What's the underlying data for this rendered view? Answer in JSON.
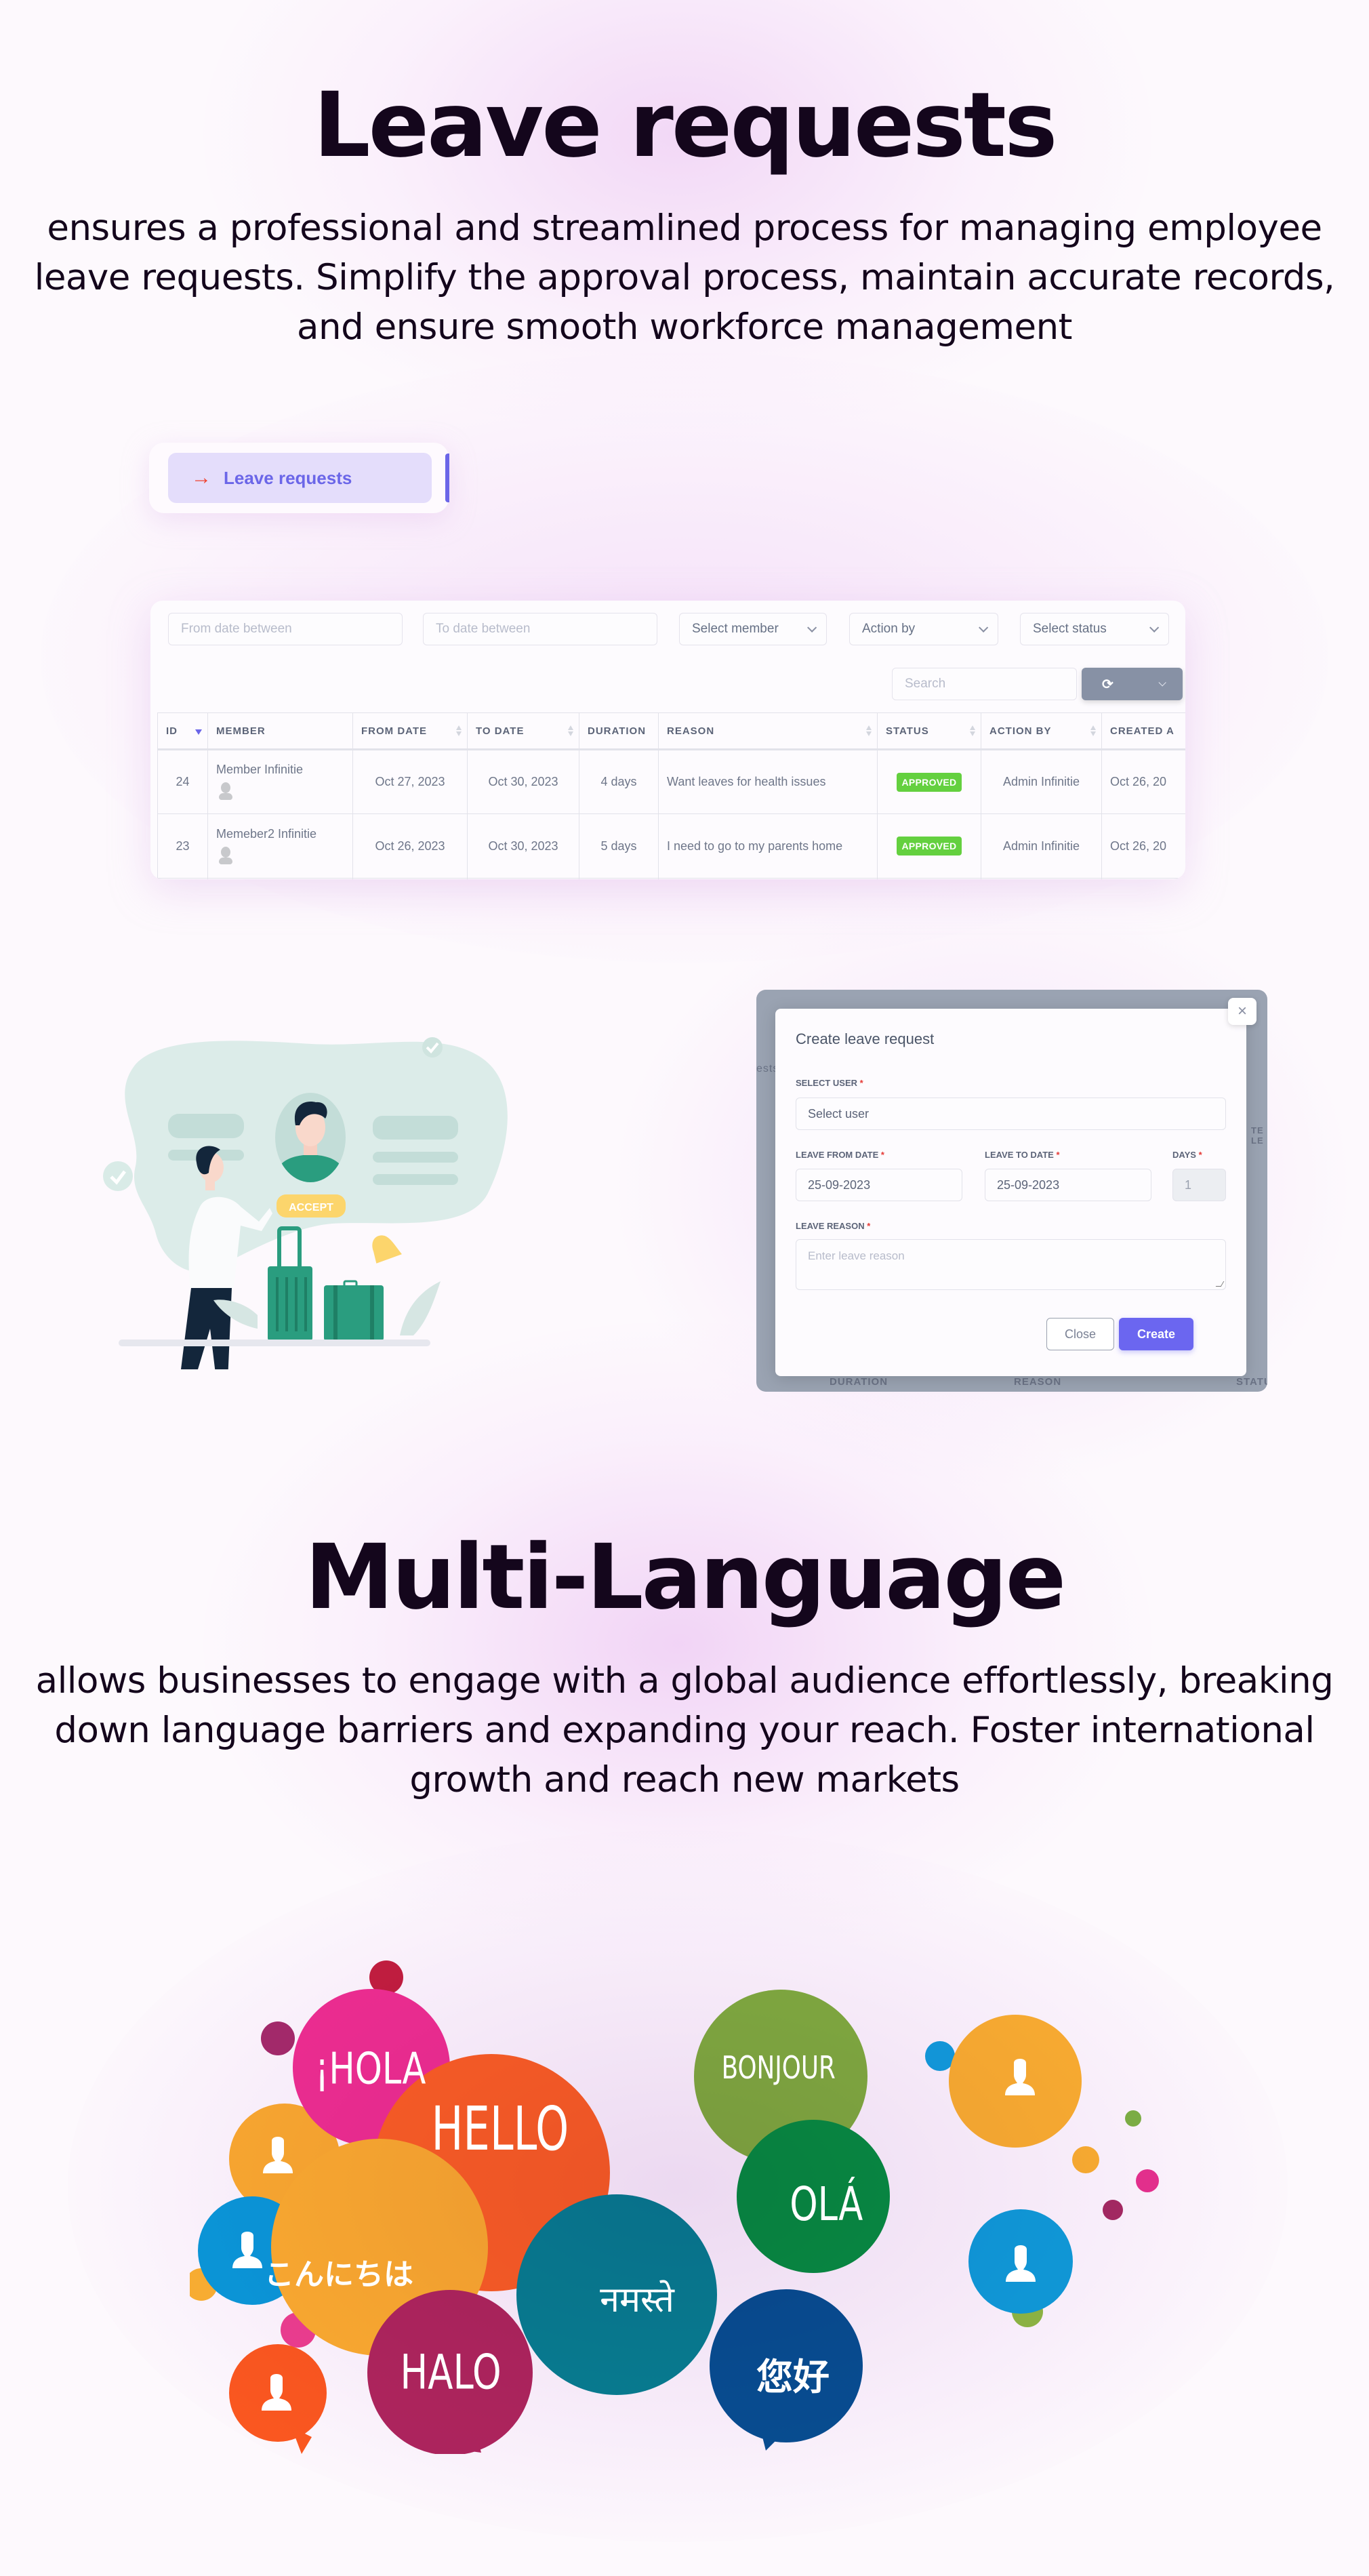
{
  "leave_section": {
    "title": "Leave requests",
    "description": "ensures a professional and streamlined process for managing employee leave requests. Simplify the approval process, maintain accurate records, and ensure smooth workforce management"
  },
  "nav": {
    "item_label": "Leave requests",
    "icon": "arrow-right-icon",
    "accent": "#6b66e8",
    "arrow_color": "#f0432f"
  },
  "table_view": {
    "filters": {
      "from_date_placeholder": "From date between",
      "to_date_placeholder": "To date between",
      "member_select": "Select member",
      "action_by_select": "Action by",
      "status_select": "Select status"
    },
    "search_placeholder": "Search",
    "refresh_icon": "refresh-icon",
    "columns": [
      "ID",
      "MEMBER",
      "FROM DATE",
      "TO DATE",
      "DURATION",
      "REASON",
      "STATUS",
      "ACTION BY",
      "CREATED A"
    ],
    "rows": [
      {
        "id": "24",
        "member": "Member Infinitie",
        "from": "Oct 27, 2023",
        "to": "Oct 30, 2023",
        "duration": "4 days",
        "reason": "Want leaves for health issues",
        "status": "APPROVED",
        "action_by": "Admin Infinitie",
        "created": "Oct 26, 20"
      },
      {
        "id": "23",
        "member": "Memeber2 Infinitie",
        "from": "Oct 26, 2023",
        "to": "Oct 30, 2023",
        "duration": "5 days",
        "reason": "I need to go to my parents home",
        "status": "APPROVED",
        "action_by": "Admin Infinitie",
        "created": "Oct 26, 20"
      }
    ],
    "status_color": "#64d03f"
  },
  "illustration": {
    "button_label": "ACCEPT"
  },
  "modal": {
    "title": "Create leave request",
    "select_user_label": "SELECT USER",
    "select_user_placeholder": "Select user",
    "from_date_label": "LEAVE FROM DATE",
    "from_date_value": "25-09-2023",
    "to_date_label": "LEAVE TO DATE",
    "to_date_value": "25-09-2023",
    "days_label": "DAYS",
    "days_value": "1",
    "reason_label": "LEAVE REASON",
    "reason_placeholder": "Enter leave reason",
    "required_mark": "*",
    "close_label": "Close",
    "create_label": "Create",
    "close_icon": "×",
    "backdrop_texts": {
      "left": "ests",
      "right": "TE LE",
      "duration": "DURATION",
      "reason": "REASON",
      "status": "STATU"
    },
    "create_color": "#6b66f0"
  },
  "language_section": {
    "title": "Multi-Language",
    "description": "allows businesses to engage with a global audience effortlessly, breaking down language barriers and expanding your reach. Foster international growth and reach new markets",
    "greetings": [
      "¡HOLA",
      "HELLO",
      "BONJOUR",
      "OLÁ",
      "こんにちは",
      "नमस्ते",
      "HALO",
      "您好"
    ]
  }
}
